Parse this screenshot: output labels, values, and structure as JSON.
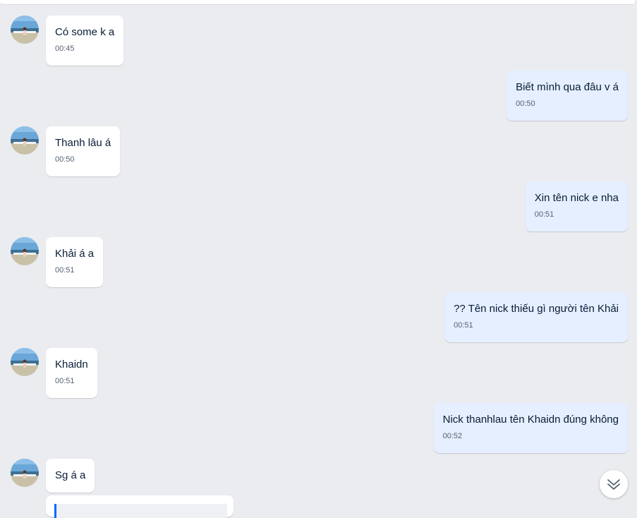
{
  "colors": {
    "background": "#ebecf0",
    "incoming_bubble": "#ffffff",
    "outgoing_bubble": "#e5efff",
    "text": "#081c36",
    "time": "#556270",
    "accent": "#0068ff"
  },
  "avatar": {
    "icon": "sender-avatar-photo"
  },
  "messages": [
    {
      "direction": "in",
      "text": "Có some k a",
      "time": "00:45"
    },
    {
      "direction": "out",
      "text": "Biết mình qua đâu v á",
      "time": "00:50"
    },
    {
      "direction": "in",
      "text": "Thanh lâu á",
      "time": "00:50"
    },
    {
      "direction": "out",
      "text": "Xin tên nick e nha",
      "time": "00:51"
    },
    {
      "direction": "in",
      "text": "Khải á a",
      "time": "00:51"
    },
    {
      "direction": "out",
      "text": "?? Tên nick thiếu gì người tên Khải",
      "time": "00:51"
    },
    {
      "direction": "in",
      "text": "Khaidn",
      "time": "00:51"
    },
    {
      "direction": "out",
      "text": "Nick thanhlau tên Khaidn đúng không",
      "time": "00:52"
    },
    {
      "direction": "in",
      "text": "Sg á a",
      "time": ""
    }
  ],
  "scroll_button": {
    "icon": "double-chevron-down-icon"
  }
}
